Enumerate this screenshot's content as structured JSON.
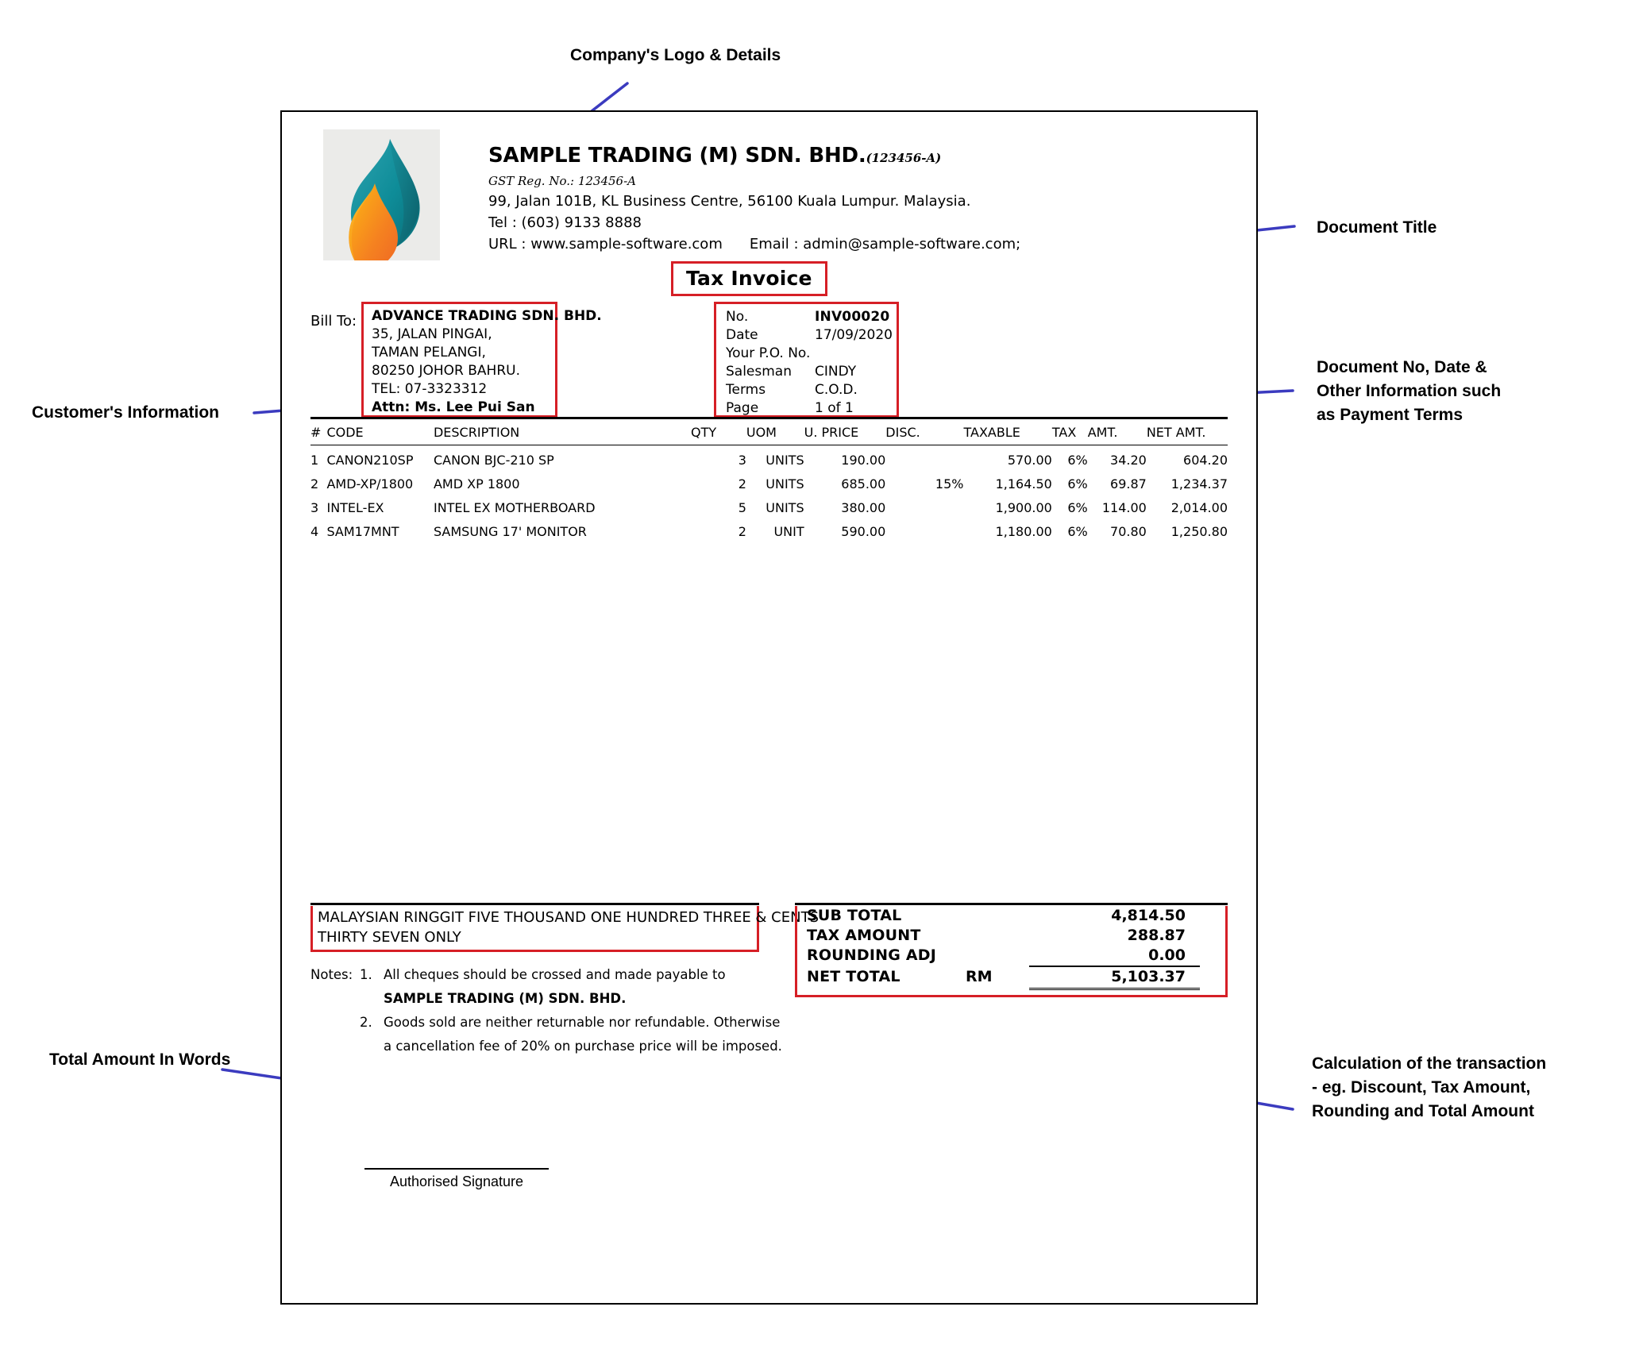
{
  "annotations": [
    {
      "id": "logo",
      "text": "Company's Logo & Details"
    },
    {
      "id": "title",
      "text": "Document Title"
    },
    {
      "id": "customer",
      "text": "Customer's Information"
    },
    {
      "id": "docinfo",
      "text": "Document No, Date &\nOther Information such\nas Payment Terms"
    },
    {
      "id": "words",
      "text": "Total Amount In Words"
    },
    {
      "id": "calc",
      "text": "Calculation of the transaction\n- eg. Discount, Tax Amount,\n      Rounding and Total Amount"
    }
  ],
  "company": {
    "name": "SAMPLE TRADING (M) SDN. BHD.",
    "reg_no": "(123456-A)",
    "gst_line": "GST Reg. No.: 123456-A",
    "address": "99, Jalan 101B,  KL Business Centre, 56100 Kuala Lumpur. Malaysia.",
    "tel": "Tel : (603) 9133 8888",
    "url_label": "URL : www.sample-software.com",
    "email_label": "Email : admin@sample-software.com;",
    "logo_icon": "flame-logo-icon"
  },
  "document": {
    "title": "Tax Invoice"
  },
  "bill_to": {
    "label": "Bill To:",
    "lines": [
      "ADVANCE TRADING SDN. BHD.",
      "35, JALAN PINGAI,",
      "TAMAN PELANGI,",
      "80250 JOHOR BAHRU.",
      "TEL: 07-3323312",
      "Attn: Ms. Lee Pui San"
    ]
  },
  "meta": {
    "rows": [
      {
        "key": "No.",
        "value": "INV00020",
        "bold": true
      },
      {
        "key": "Date",
        "value": "17/09/2020",
        "bold": false
      },
      {
        "key": "Your P.O. No.",
        "value": "",
        "bold": false
      },
      {
        "key": "Salesman",
        "value": "CINDY",
        "bold": false
      },
      {
        "key": "Terms",
        "value": "C.O.D.",
        "bold": false
      },
      {
        "key": "Page",
        "value": "1 of 1",
        "bold": false
      }
    ]
  },
  "items": {
    "headers": [
      "#",
      "CODE",
      "DESCRIPTION",
      "QTY",
      "UOM",
      "U. PRICE",
      "DISC.",
      "TAXABLE",
      "TAX",
      "AMT.",
      "NET AMT."
    ],
    "rows": [
      {
        "num": "1",
        "code": "CANON210SP",
        "desc": "CANON BJC-210 SP",
        "qty": "3",
        "uom": "UNITS",
        "price": "190.00",
        "disc": "",
        "taxable": "570.00",
        "tax": "6%",
        "amt": "34.20",
        "net": "604.20"
      },
      {
        "num": "2",
        "code": "AMD-XP/1800",
        "desc": "AMD XP 1800",
        "qty": "2",
        "uom": "UNITS",
        "price": "685.00",
        "disc": "15%",
        "taxable": "1,164.50",
        "tax": "6%",
        "amt": "69.87",
        "net": "1,234.37"
      },
      {
        "num": "3",
        "code": "INTEL-EX",
        "desc": "INTEL EX MOTHERBOARD",
        "qty": "5",
        "uom": "UNITS",
        "price": "380.00",
        "disc": "",
        "taxable": "1,900.00",
        "tax": "6%",
        "amt": "114.00",
        "net": "2,014.00"
      },
      {
        "num": "4",
        "code": "SAM17MNT",
        "desc": "SAMSUNG 17' MONITOR",
        "qty": "2",
        "uom": "UNIT",
        "price": "590.00",
        "disc": "",
        "taxable": "1,180.00",
        "tax": "6%",
        "amt": "70.80",
        "net": "1,250.80"
      }
    ]
  },
  "amount_in_words": {
    "line1": "MALAYSIAN RINGGIT FIVE THOUSAND ONE HUNDRED THREE  & CENTS",
    "line2": "THIRTY SEVEN  ONLY"
  },
  "notes": {
    "label": "Notes:",
    "n1_num": "1.",
    "n1_text": "All cheques should be crossed and made payable to",
    "n1_payee": "SAMPLE TRADING (M) SDN. BHD.",
    "n2_num": "2.",
    "n2_text": "Goods sold are neither returnable nor refundable. Otherwise",
    "n2_text_cont": "a cancellation fee of 20% on purchase price will be imposed."
  },
  "totals": {
    "sub_total_label": "SUB TOTAL",
    "sub_total_value": "4,814.50",
    "tax_label": "TAX AMOUNT",
    "tax_value": "288.87",
    "rounding_label": "ROUNDING ADJ",
    "rounding_value": "0.00",
    "net_label": "NET TOTAL",
    "net_currency": "RM",
    "net_value": "5,103.37"
  },
  "signature": {
    "caption": "Authorised Signature"
  },
  "colors": {
    "accent_red": "#d61f26",
    "leader_blue": "#3b3bbf",
    "logo_teal": "#168b96",
    "logo_orange": "#f28c1c",
    "logo_bg": "#ebebe9"
  }
}
